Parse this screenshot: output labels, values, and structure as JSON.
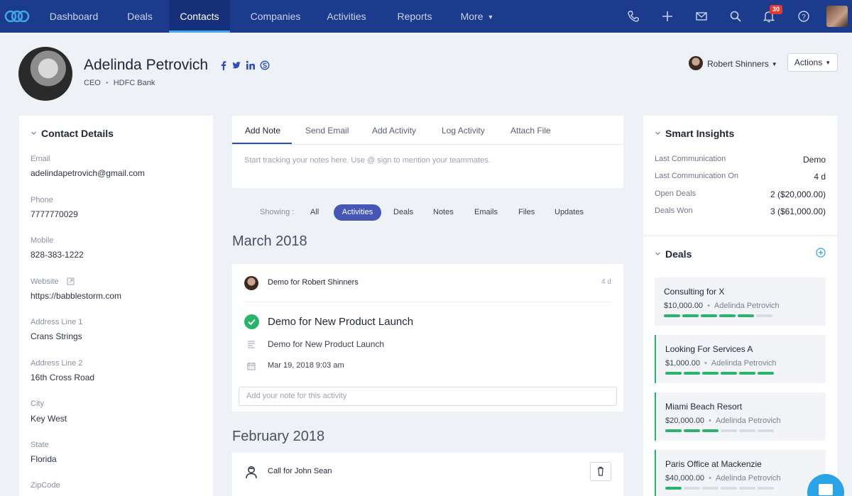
{
  "nav": {
    "items": [
      {
        "label": "Dashboard"
      },
      {
        "label": "Deals"
      },
      {
        "label": "Contacts"
      },
      {
        "label": "Companies"
      },
      {
        "label": "Activities"
      },
      {
        "label": "Reports"
      },
      {
        "label": "More"
      }
    ],
    "active": "Contacts",
    "notification_count": "30",
    "icons": [
      "phone-icon",
      "plus-icon",
      "mail-icon",
      "search-icon",
      "bell-icon",
      "help-icon"
    ]
  },
  "profile": {
    "name": "Adelinda Petrovich",
    "title": "CEO",
    "company": "HDFC Bank",
    "social_icons": [
      "facebook-icon",
      "twitter-icon",
      "linkedin-icon",
      "skype-icon"
    ]
  },
  "owner": {
    "name": "Robert Shinners"
  },
  "actions_label": "Actions",
  "contact_details": {
    "heading": "Contact Details",
    "fields": [
      {
        "label": "Email",
        "value": "adelindapetrovich@gmail.com"
      },
      {
        "label": "Phone",
        "value": "7777770029"
      },
      {
        "label": "Mobile",
        "value": "828-383-1222"
      },
      {
        "label": "Website",
        "value": "https://babblestorm.com"
      },
      {
        "label": "Address Line 1",
        "value": "Crans Strings"
      },
      {
        "label": "Address Line 2",
        "value": "16th Cross Road"
      },
      {
        "label": "City",
        "value": "Key West"
      },
      {
        "label": "State",
        "value": "Florida"
      },
      {
        "label": "ZipCode",
        "value": ""
      }
    ]
  },
  "composer": {
    "tabs": [
      "Add Note",
      "Send Email",
      "Add Activity",
      "Log Activity",
      "Attach File"
    ],
    "active_tab": "Add Note",
    "placeholder": "Start tracking your notes here. Use @ sign to mention your teammates."
  },
  "filter": {
    "label": "Showing :",
    "options": [
      "All",
      "Activities",
      "Deals",
      "Notes",
      "Emails",
      "Files",
      "Updates"
    ],
    "selected": "Activities"
  },
  "timeline": [
    {
      "month": "March 2018",
      "entry": {
        "type": "Demo",
        "connector": "for",
        "person": "Robert Shinners",
        "time_ago": "4 d",
        "title": "Demo for New Product Launch",
        "description": "Demo for New Product Launch",
        "datetime": "Mar 19, 2018 9:03 am",
        "note_placeholder": "Add your note for this activity"
      }
    },
    {
      "month": "February 2018",
      "entry": {
        "type": "Call",
        "connector": "for",
        "person": "John Sean"
      }
    }
  ],
  "insights": {
    "heading": "Smart Insights",
    "rows": [
      {
        "label": "Last Communication",
        "value": "Demo"
      },
      {
        "label": "Last Communication On",
        "value": "4 d"
      },
      {
        "label": "Open Deals",
        "value": "2 ($20,000.00)"
      },
      {
        "label": "Deals Won",
        "value": "3 ($61,000.00)"
      }
    ]
  },
  "deals": {
    "heading": "Deals",
    "items": [
      {
        "name": "Consulting for X",
        "amount": "$10,000.00",
        "person": "Adelinda Petrovich",
        "stages_done": 5,
        "stages_total": 6
      },
      {
        "name": "Looking For Services A",
        "amount": "$1,000.00",
        "person": "Adelinda Petrovich",
        "stages_done": 6,
        "stages_total": 6
      },
      {
        "name": "Miami Beach Resort",
        "amount": "$20,000.00",
        "person": "Adelinda Petrovich",
        "stages_done": 3,
        "stages_total": 6
      },
      {
        "name": "Paris Office at Mackenzie",
        "amount": "$40,000.00",
        "person": "Adelinda Petrovich",
        "stages_done": 1,
        "stages_total": 6
      }
    ]
  },
  "colors": {
    "nav_bg": "#1c3b8c",
    "accent": "#4457b5",
    "success": "#28b56b",
    "badge": "#e53935",
    "fab": "#2aa3e8"
  }
}
